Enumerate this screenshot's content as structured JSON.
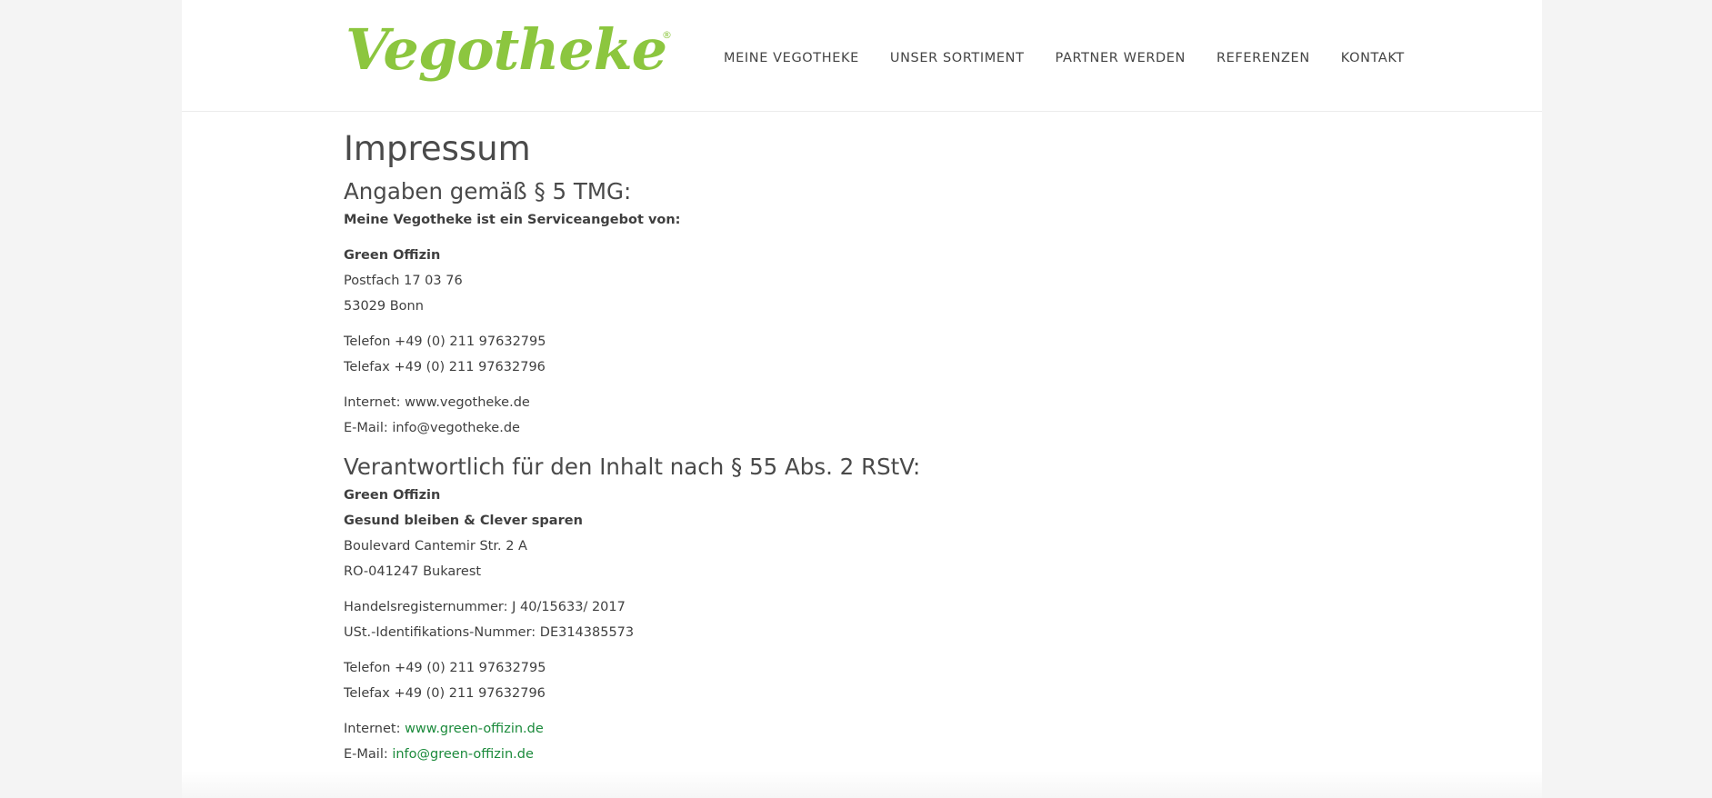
{
  "header": {
    "logo_text": "Vegotheke",
    "logo_mark": "®",
    "nav": [
      "MEINE VEGOTHEKE",
      "UNSER SORTIMENT",
      "PARTNER WERDEN",
      "REFERENZEN",
      "KONTAKT"
    ]
  },
  "content": {
    "title": "Impressum",
    "section1": {
      "heading": "Angaben gemäß § 5 TMG:",
      "intro": "Meine Vegotheke ist ein Serviceangebot von:",
      "company": "Green Offizin",
      "address_line1": "Postfach 17 03 76",
      "address_line2": "53029 Bonn",
      "phone": "Telefon +49 (0) 211 97632795",
      "fax": "Telefax +49 (0) 211 97632796",
      "internet": "Internet: www.vegotheke.de",
      "email": "E-Mail: info@vegotheke.de"
    },
    "section2": {
      "heading": "Verantwortlich für den Inhalt nach § 55 Abs. 2 RStV:",
      "company": "Green Offizin",
      "slogan": "Gesund bleiben & Clever sparen",
      "address_line1": "Boulevard Cantemir Str. 2 A",
      "address_line2": "RO-041247 Bukarest",
      "register": "Handelsregisternummer: J 40/15633/ 2017",
      "vat": "USt.-Identifikations-Nummer: DE314385573",
      "phone": "Telefon +49 (0) 211 97632795",
      "fax": "Telefax +49 (0) 211 97632796",
      "internet_label": "Internet: ",
      "internet_link": "www.green-offizin.de",
      "email_label": "E-Mail: ",
      "email_link": "info@green-offizin.de"
    }
  },
  "colors": {
    "brand_green": "#8cc63f",
    "link_green": "#1b8a3b",
    "text": "#3f3f3f",
    "background": "#f4f4f4"
  }
}
